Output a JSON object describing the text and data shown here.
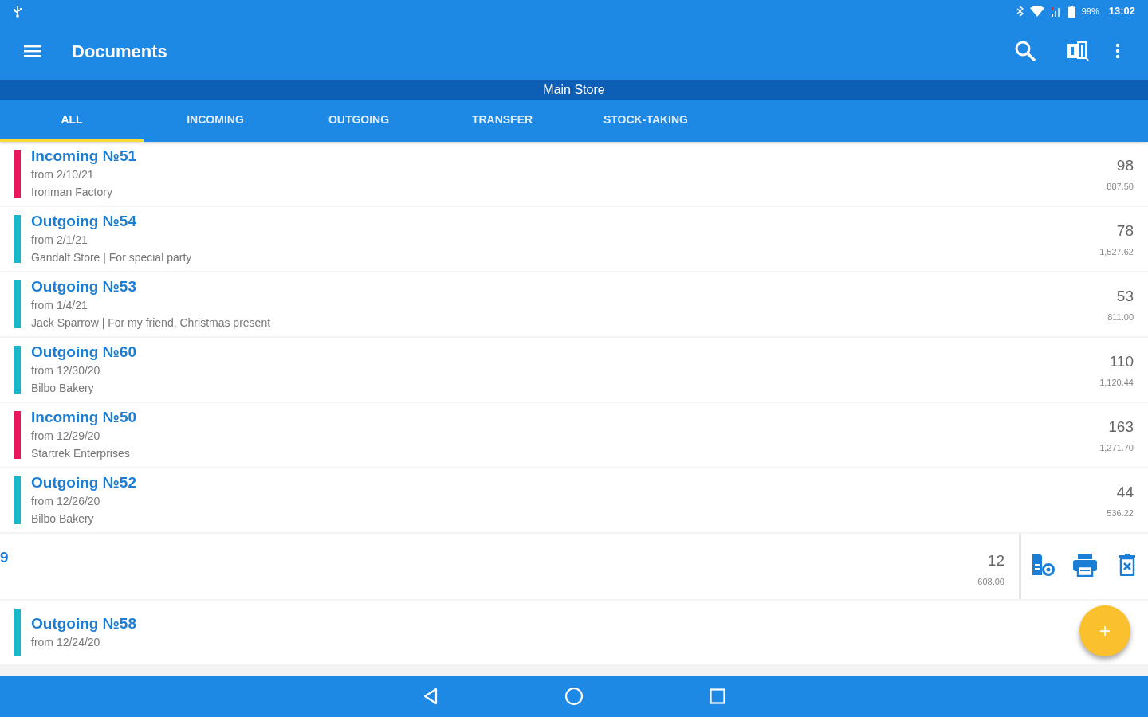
{
  "status_bar": {
    "battery": "99%",
    "time": "13:02"
  },
  "toolbar": {
    "title": "Documents"
  },
  "store": "Main Store",
  "tabs": [
    {
      "label": "ALL",
      "selected": true
    },
    {
      "label": "INCOMING",
      "selected": false
    },
    {
      "label": "OUTGOING",
      "selected": false
    },
    {
      "label": "TRANSFER",
      "selected": false
    },
    {
      "label": "STOCK-TAKING",
      "selected": false
    }
  ],
  "documents": [
    {
      "kind": "document",
      "color": "#e8185a",
      "title": "Incoming №51",
      "date": "from 2/10/21",
      "note": "Ironman Factory",
      "count": "98",
      "amount": "887.50"
    },
    {
      "kind": "document",
      "color": "#19b5c9",
      "title": "Outgoing №54",
      "date": "from 2/1/21",
      "note": "Gandalf Store | For special party",
      "count": "78",
      "amount": "1,527.62"
    },
    {
      "kind": "document",
      "color": "#19b5c9",
      "title": "Outgoing №53",
      "date": "from 1/4/21",
      "note": "Jack Sparrow  | For my friend, Christmas present",
      "count": "53",
      "amount": "811.00"
    },
    {
      "kind": "document",
      "color": "#19b5c9",
      "title": "Outgoing №60",
      "date": "from 12/30/20",
      "note": "Bilbo Bakery",
      "count": "110",
      "amount": "1,120.44"
    },
    {
      "kind": "document",
      "color": "#e8185a",
      "title": "Incoming №50",
      "date": "from 12/29/20",
      "note": "Startrek Enterprises",
      "count": "163",
      "amount": "1,271.70"
    },
    {
      "kind": "document",
      "color": "#19b5c9",
      "title": "Outgoing №52",
      "date": "from 12/26/20",
      "note": "Bilbo Bakery",
      "count": "44",
      "amount": "536.22"
    },
    {
      "kind": "swiped",
      "title": "9",
      "count": "12",
      "amount": "608.00"
    },
    {
      "kind": "document",
      "color": "#19b5c9",
      "title": "Outgoing №58",
      "date": "from 12/24/20"
    }
  ],
  "fab": "+"
}
